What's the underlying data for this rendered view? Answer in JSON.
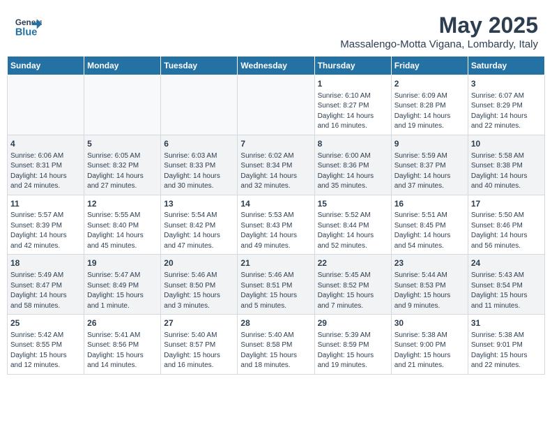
{
  "header": {
    "logo_general": "General",
    "logo_blue": "Blue",
    "month_year": "May 2025",
    "location": "Massalengo-Motta Vigana, Lombardy, Italy"
  },
  "weekdays": [
    "Sunday",
    "Monday",
    "Tuesday",
    "Wednesday",
    "Thursday",
    "Friday",
    "Saturday"
  ],
  "weeks": [
    [
      {
        "day": "",
        "info": ""
      },
      {
        "day": "",
        "info": ""
      },
      {
        "day": "",
        "info": ""
      },
      {
        "day": "",
        "info": ""
      },
      {
        "day": "1",
        "info": "Sunrise: 6:10 AM\nSunset: 8:27 PM\nDaylight: 14 hours\nand 16 minutes."
      },
      {
        "day": "2",
        "info": "Sunrise: 6:09 AM\nSunset: 8:28 PM\nDaylight: 14 hours\nand 19 minutes."
      },
      {
        "day": "3",
        "info": "Sunrise: 6:07 AM\nSunset: 8:29 PM\nDaylight: 14 hours\nand 22 minutes."
      }
    ],
    [
      {
        "day": "4",
        "info": "Sunrise: 6:06 AM\nSunset: 8:31 PM\nDaylight: 14 hours\nand 24 minutes."
      },
      {
        "day": "5",
        "info": "Sunrise: 6:05 AM\nSunset: 8:32 PM\nDaylight: 14 hours\nand 27 minutes."
      },
      {
        "day": "6",
        "info": "Sunrise: 6:03 AM\nSunset: 8:33 PM\nDaylight: 14 hours\nand 30 minutes."
      },
      {
        "day": "7",
        "info": "Sunrise: 6:02 AM\nSunset: 8:34 PM\nDaylight: 14 hours\nand 32 minutes."
      },
      {
        "day": "8",
        "info": "Sunrise: 6:00 AM\nSunset: 8:36 PM\nDaylight: 14 hours\nand 35 minutes."
      },
      {
        "day": "9",
        "info": "Sunrise: 5:59 AM\nSunset: 8:37 PM\nDaylight: 14 hours\nand 37 minutes."
      },
      {
        "day": "10",
        "info": "Sunrise: 5:58 AM\nSunset: 8:38 PM\nDaylight: 14 hours\nand 40 minutes."
      }
    ],
    [
      {
        "day": "11",
        "info": "Sunrise: 5:57 AM\nSunset: 8:39 PM\nDaylight: 14 hours\nand 42 minutes."
      },
      {
        "day": "12",
        "info": "Sunrise: 5:55 AM\nSunset: 8:40 PM\nDaylight: 14 hours\nand 45 minutes."
      },
      {
        "day": "13",
        "info": "Sunrise: 5:54 AM\nSunset: 8:42 PM\nDaylight: 14 hours\nand 47 minutes."
      },
      {
        "day": "14",
        "info": "Sunrise: 5:53 AM\nSunset: 8:43 PM\nDaylight: 14 hours\nand 49 minutes."
      },
      {
        "day": "15",
        "info": "Sunrise: 5:52 AM\nSunset: 8:44 PM\nDaylight: 14 hours\nand 52 minutes."
      },
      {
        "day": "16",
        "info": "Sunrise: 5:51 AM\nSunset: 8:45 PM\nDaylight: 14 hours\nand 54 minutes."
      },
      {
        "day": "17",
        "info": "Sunrise: 5:50 AM\nSunset: 8:46 PM\nDaylight: 14 hours\nand 56 minutes."
      }
    ],
    [
      {
        "day": "18",
        "info": "Sunrise: 5:49 AM\nSunset: 8:47 PM\nDaylight: 14 hours\nand 58 minutes."
      },
      {
        "day": "19",
        "info": "Sunrise: 5:47 AM\nSunset: 8:49 PM\nDaylight: 15 hours\nand 1 minute."
      },
      {
        "day": "20",
        "info": "Sunrise: 5:46 AM\nSunset: 8:50 PM\nDaylight: 15 hours\nand 3 minutes."
      },
      {
        "day": "21",
        "info": "Sunrise: 5:46 AM\nSunset: 8:51 PM\nDaylight: 15 hours\nand 5 minutes."
      },
      {
        "day": "22",
        "info": "Sunrise: 5:45 AM\nSunset: 8:52 PM\nDaylight: 15 hours\nand 7 minutes."
      },
      {
        "day": "23",
        "info": "Sunrise: 5:44 AM\nSunset: 8:53 PM\nDaylight: 15 hours\nand 9 minutes."
      },
      {
        "day": "24",
        "info": "Sunrise: 5:43 AM\nSunset: 8:54 PM\nDaylight: 15 hours\nand 11 minutes."
      }
    ],
    [
      {
        "day": "25",
        "info": "Sunrise: 5:42 AM\nSunset: 8:55 PM\nDaylight: 15 hours\nand 12 minutes."
      },
      {
        "day": "26",
        "info": "Sunrise: 5:41 AM\nSunset: 8:56 PM\nDaylight: 15 hours\nand 14 minutes."
      },
      {
        "day": "27",
        "info": "Sunrise: 5:40 AM\nSunset: 8:57 PM\nDaylight: 15 hours\nand 16 minutes."
      },
      {
        "day": "28",
        "info": "Sunrise: 5:40 AM\nSunset: 8:58 PM\nDaylight: 15 hours\nand 18 minutes."
      },
      {
        "day": "29",
        "info": "Sunrise: 5:39 AM\nSunset: 8:59 PM\nDaylight: 15 hours\nand 19 minutes."
      },
      {
        "day": "30",
        "info": "Sunrise: 5:38 AM\nSunset: 9:00 PM\nDaylight: 15 hours\nand 21 minutes."
      },
      {
        "day": "31",
        "info": "Sunrise: 5:38 AM\nSunset: 9:01 PM\nDaylight: 15 hours\nand 22 minutes."
      }
    ]
  ]
}
